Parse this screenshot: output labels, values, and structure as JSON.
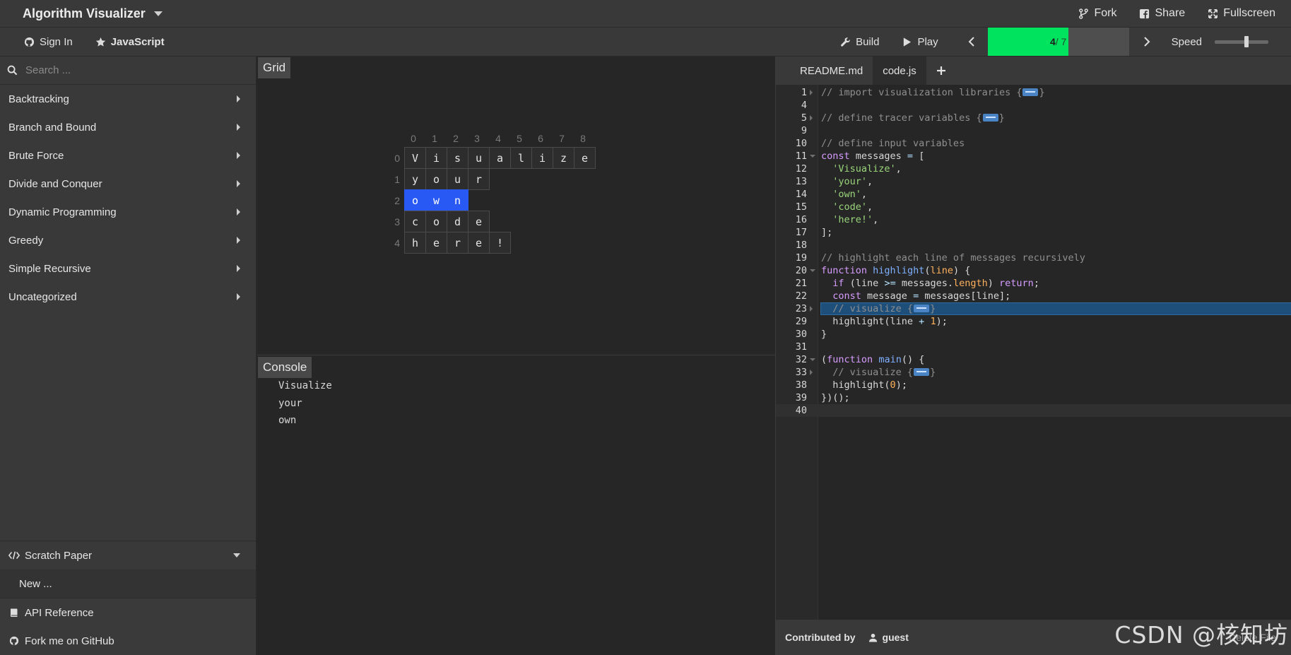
{
  "header": {
    "title": "Algorithm Visualizer",
    "fork_label": "Fork",
    "share_label": "Share",
    "fullscreen_label": "Fullscreen"
  },
  "toolbar": {
    "signin_label": "Sign In",
    "language_label": "JavaScript",
    "build_label": "Build",
    "play_label": "Play",
    "step_current": "4",
    "step_total": " / 7",
    "progress_fraction": 0.57,
    "speed_label": "Speed",
    "speed_fraction": 0.6
  },
  "sidebar": {
    "search_placeholder": "Search ...",
    "categories": [
      "Backtracking",
      "Branch and Bound",
      "Brute Force",
      "Divide and Conquer",
      "Dynamic Programming",
      "Greedy",
      "Simple Recursive",
      "Uncategorized"
    ],
    "scratch_label": "Scratch Paper",
    "new_label": "New ...",
    "api_label": "API Reference",
    "github_label": "Fork me on GitHub"
  },
  "grid_panel": {
    "tab_label": "Grid",
    "col_indices": [
      "0",
      "1",
      "2",
      "3",
      "4",
      "5",
      "6",
      "7",
      "8"
    ],
    "row_indices": [
      "0",
      "1",
      "2",
      "3",
      "4"
    ],
    "rows": [
      [
        "V",
        "i",
        "s",
        "u",
        "a",
        "l",
        "i",
        "z",
        "e"
      ],
      [
        "y",
        "o",
        "u",
        "r"
      ],
      [
        "o",
        "w",
        "n"
      ],
      [
        "c",
        "o",
        "d",
        "e"
      ],
      [
        "h",
        "e",
        "r",
        "e",
        "!"
      ]
    ],
    "highlighted_row": 2
  },
  "console_panel": {
    "tab_label": "Console",
    "lines": [
      "Visualize",
      "your",
      "own"
    ]
  },
  "editor": {
    "tabs": [
      "README.md",
      "code.js"
    ],
    "active_tab": 1,
    "highlighted_line": "23",
    "cursor_line": "40",
    "lines": [
      {
        "n": "1",
        "fold": "r",
        "html": "<span class=\"c-cm\">// import visualization libraries {</span><span class=\"fold-mark\"></span><span class=\"c-cm\">}</span>"
      },
      {
        "n": "4",
        "fold": "",
        "html": ""
      },
      {
        "n": "5",
        "fold": "r",
        "html": "<span class=\"c-cm\">// define tracer variables {</span><span class=\"fold-mark\"></span><span class=\"c-cm\">}</span>"
      },
      {
        "n": "9",
        "fold": "",
        "html": ""
      },
      {
        "n": "10",
        "fold": "",
        "html": "<span class=\"c-cm\">// define input variables</span>"
      },
      {
        "n": "11",
        "fold": "d",
        "html": "<span class=\"c-kw\">const</span> messages <span class=\"c-op\">=</span> ["
      },
      {
        "n": "12",
        "fold": "",
        "html": "  <span class=\"c-st\">'Visualize'</span>,"
      },
      {
        "n": "13",
        "fold": "",
        "html": "  <span class=\"c-st\">'your'</span>,"
      },
      {
        "n": "14",
        "fold": "",
        "html": "  <span class=\"c-st\">'own'</span>,"
      },
      {
        "n": "15",
        "fold": "",
        "html": "  <span class=\"c-st\">'code'</span>,"
      },
      {
        "n": "16",
        "fold": "",
        "html": "  <span class=\"c-st\">'here!'</span>,"
      },
      {
        "n": "17",
        "fold": "",
        "html": "];"
      },
      {
        "n": "18",
        "fold": "",
        "html": ""
      },
      {
        "n": "19",
        "fold": "",
        "html": "<span class=\"c-cm\">// highlight each line of messages recursively</span>"
      },
      {
        "n": "20",
        "fold": "d",
        "html": "<span class=\"c-kw\">function</span> <span class=\"c-fn\">highlight</span>(<span class=\"c-pr\">line</span>) {"
      },
      {
        "n": "21",
        "fold": "",
        "html": "  <span class=\"c-kw\">if</span> (line <span class=\"c-op\">&gt;=</span> messages.<span class=\"c-pr\">length</span>) <span class=\"c-kw\">return</span>;"
      },
      {
        "n": "22",
        "fold": "",
        "html": "  <span class=\"c-kw\">const</span> message <span class=\"c-op\">=</span> messages[line];"
      },
      {
        "n": "23",
        "fold": "r",
        "html": "  <span class=\"c-cm\">// visualize {</span><span class=\"fold-mark\"></span><span class=\"c-cm\">}</span>"
      },
      {
        "n": "29",
        "fold": "",
        "html": "  highlight(line <span class=\"c-op\">+</span> <span class=\"c-pr\">1</span>);"
      },
      {
        "n": "30",
        "fold": "",
        "html": "}"
      },
      {
        "n": "31",
        "fold": "",
        "html": ""
      },
      {
        "n": "32",
        "fold": "d",
        "html": "(<span class=\"c-kw\">function</span> <span class=\"c-fn\">main</span>() {"
      },
      {
        "n": "33",
        "fold": "r",
        "html": "  <span class=\"c-cm\">// visualize {</span><span class=\"fold-mark\"></span><span class=\"c-cm\">}</span>"
      },
      {
        "n": "38",
        "fold": "",
        "html": "  highlight(<span class=\"c-pr\">0</span>);"
      },
      {
        "n": "39",
        "fold": "",
        "html": "})();"
      },
      {
        "n": "40",
        "fold": "",
        "html": ""
      }
    ],
    "contributed_label": "Contributed by",
    "contributor": "guest",
    "delete_label": "Delete File"
  },
  "watermark": "CSDN @核知坊",
  "colors": {
    "accent_green": "#00e35f",
    "highlight_blue": "#2859f5"
  }
}
